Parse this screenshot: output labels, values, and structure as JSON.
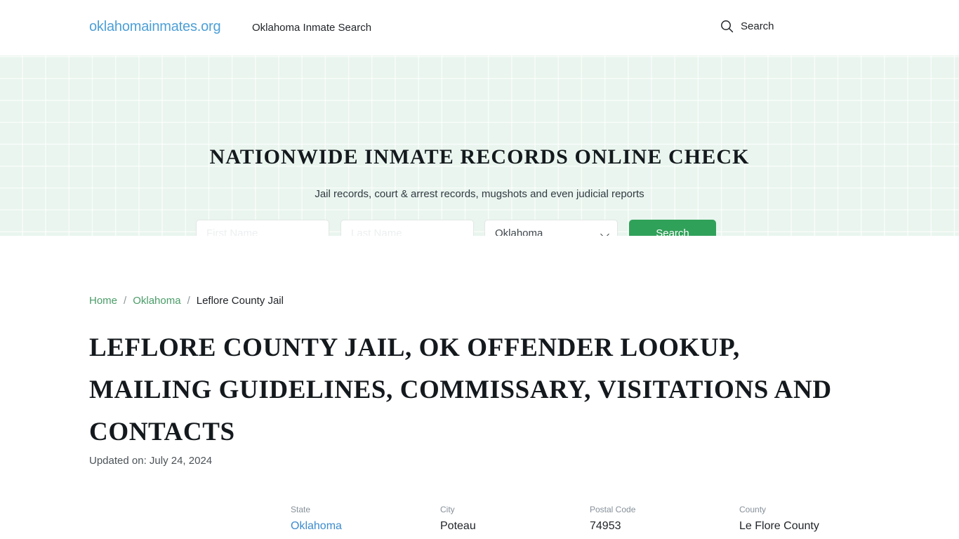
{
  "header": {
    "brand": "oklahomainmates.org",
    "nav_link": "Oklahoma Inmate Search",
    "search_label": "Search",
    "search_icon": "search-icon"
  },
  "hero": {
    "title": "NATIONWIDE INMATE RECORDS ONLINE CHECK",
    "subtitle": "Jail records, court & arrest records, mugshots and even judicial reports",
    "form": {
      "first_name_placeholder": "First Name",
      "first_name_value": "",
      "last_name_placeholder": "Last Name",
      "last_name_value": "",
      "state_selected": "Oklahoma",
      "state_options": [
        "Oklahoma"
      ],
      "chevron_icon": "chevron-down-icon",
      "submit_label": "Search"
    },
    "background_color": "#e9f5ee",
    "accent_color": "#30a159"
  },
  "breadcrumb": {
    "items": [
      {
        "label": "Home",
        "is_link": true
      },
      {
        "label": "Oklahoma",
        "is_link": true
      },
      {
        "label": "Leflore County Jail",
        "is_link": false
      }
    ],
    "separator": "/"
  },
  "main": {
    "page_title": "Leflore County Jail, OK Offender Lookup, Mailing Guidelines, Commissary, Visitations and Contacts",
    "updated": "Updated on: July 24, 2024"
  },
  "facts": [
    {
      "label": "State",
      "value": "Oklahoma",
      "is_link": true
    },
    {
      "label": "City",
      "value": "Poteau",
      "is_link": false
    },
    {
      "label": "Postal Code",
      "value": "74953",
      "is_link": false
    },
    {
      "label": "County",
      "value": "Le Flore County",
      "is_link": false
    }
  ]
}
